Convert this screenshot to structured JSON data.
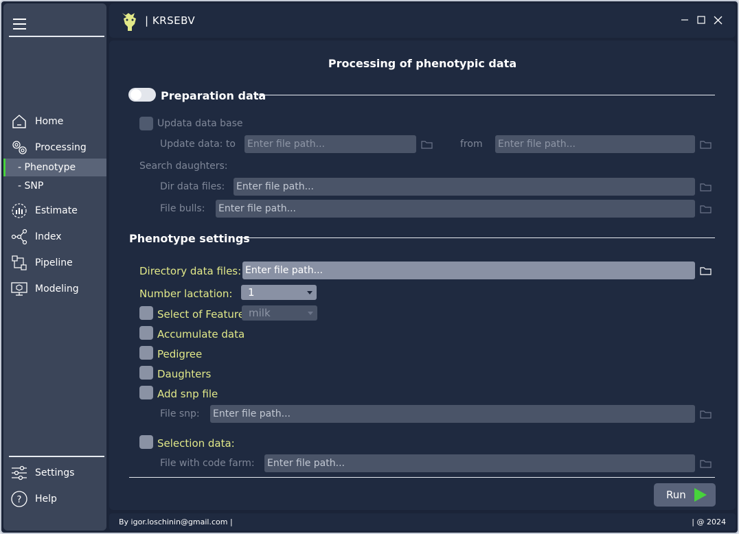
{
  "app": {
    "brand": "| KRSEBV"
  },
  "sidebar": {
    "items": [
      {
        "label": "Home",
        "icon": "home-icon"
      },
      {
        "label": "Processing",
        "icon": "gears-icon"
      },
      {
        "label": "- Phenotype",
        "active": true
      },
      {
        "label": "- SNP"
      },
      {
        "label": "Estimate",
        "icon": "chart-icon"
      },
      {
        "label": "Index",
        "icon": "network-icon"
      },
      {
        "label": "Pipeline",
        "icon": "pipeline-icon"
      },
      {
        "label": "Modeling",
        "icon": "monitor-icon"
      }
    ],
    "bottom": [
      {
        "label": "Settings",
        "icon": "sliders-icon"
      },
      {
        "label": "Help",
        "icon": "help-icon"
      }
    ],
    "accent": "#47d33b"
  },
  "main": {
    "title": "Processing of phenotypic data",
    "prep": {
      "title": "Preparation data",
      "toggle_on": false,
      "update_db": "Updata data base",
      "update_to": "Update data: to",
      "from": "from",
      "search_daughters": "Search daughters:",
      "dir_data_files": "Dir data files:",
      "file_bulls": "File bulls:"
    },
    "pheno": {
      "title": "Phenotype settings",
      "directory_data_files": "Directory data files:",
      "number_lactation": "Number lactation:",
      "number_lactation_value": "1",
      "select_feature": "Select of Feature:",
      "select_feature_value": "milk",
      "accumulate": "Accumulate data",
      "pedigree": "Pedigree",
      "daughters": "Daughters",
      "add_snp": "Add snp file",
      "file_snp": "File snp:",
      "selection_data": "Selection data:",
      "file_code_farm": "File with code farm:"
    },
    "placeholder": "Enter file path...",
    "run_label": "Run"
  },
  "footer": {
    "author": "By igor.loschinin@gmail.com |",
    "year": "| @ 2024"
  },
  "colors": {
    "label_yellow": "#e2e989",
    "background": "#1b2438",
    "panel": "#1f2a40"
  }
}
